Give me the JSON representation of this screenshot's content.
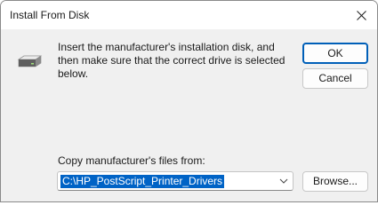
{
  "dialog": {
    "title": "Install From Disk",
    "message": "Insert the manufacturer's installation disk, and then make sure that the correct drive is selected below.",
    "buttons": {
      "ok": "OK",
      "cancel": "Cancel",
      "browse": "Browse..."
    },
    "copy_from_label": "Copy manufacturer's files from:",
    "copy_from_value": "C:\\HP_PostScript_Printer_Drivers"
  },
  "icons": {
    "close": "close-icon",
    "disk": "disk-drive-icon",
    "dropdown": "chevron-down-icon"
  },
  "colors": {
    "accent": "#005fb8",
    "selection": "#0063c6",
    "dialog_background": "#f0f0f0"
  }
}
